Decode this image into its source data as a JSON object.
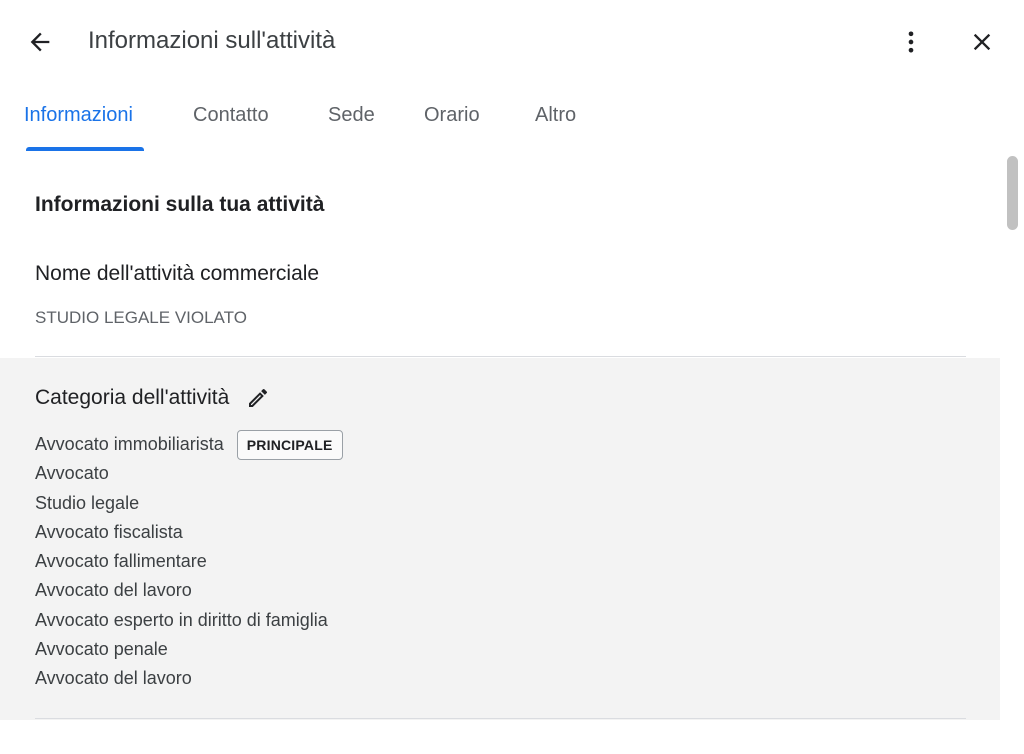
{
  "header": {
    "title": "Informazioni sull'attività",
    "back_icon": "arrow-left-icon",
    "more_icon": "more-vert-icon",
    "close_icon": "close-icon"
  },
  "tabs": [
    {
      "label": "Informazioni",
      "active": true
    },
    {
      "label": "Contatto",
      "active": false
    },
    {
      "label": "Sede",
      "active": false
    },
    {
      "label": "Orario",
      "active": false
    },
    {
      "label": "Altro",
      "active": false
    }
  ],
  "section": {
    "heading": "Informazioni sulla tua attività"
  },
  "business_name": {
    "label": "Nome dell'attività commerciale",
    "value": "STUDIO LEGALE VIOLATO"
  },
  "category": {
    "label": "Categoria dell'attività",
    "edit_icon": "pencil-icon",
    "primary_badge": "PRINCIPALE",
    "items": [
      "Avvocato immobiliarista",
      "Avvocato",
      "Studio legale",
      "Avvocato fiscalista",
      "Avvocato fallimentare",
      "Avvocato del lavoro",
      "Avvocato esperto in diritto di famiglia",
      "Avvocato penale",
      "Avvocato del lavoro"
    ]
  },
  "colors": {
    "accent": "#1a73e8",
    "highlight_bg": "#f3f3f3",
    "divider": "#dadce0"
  }
}
